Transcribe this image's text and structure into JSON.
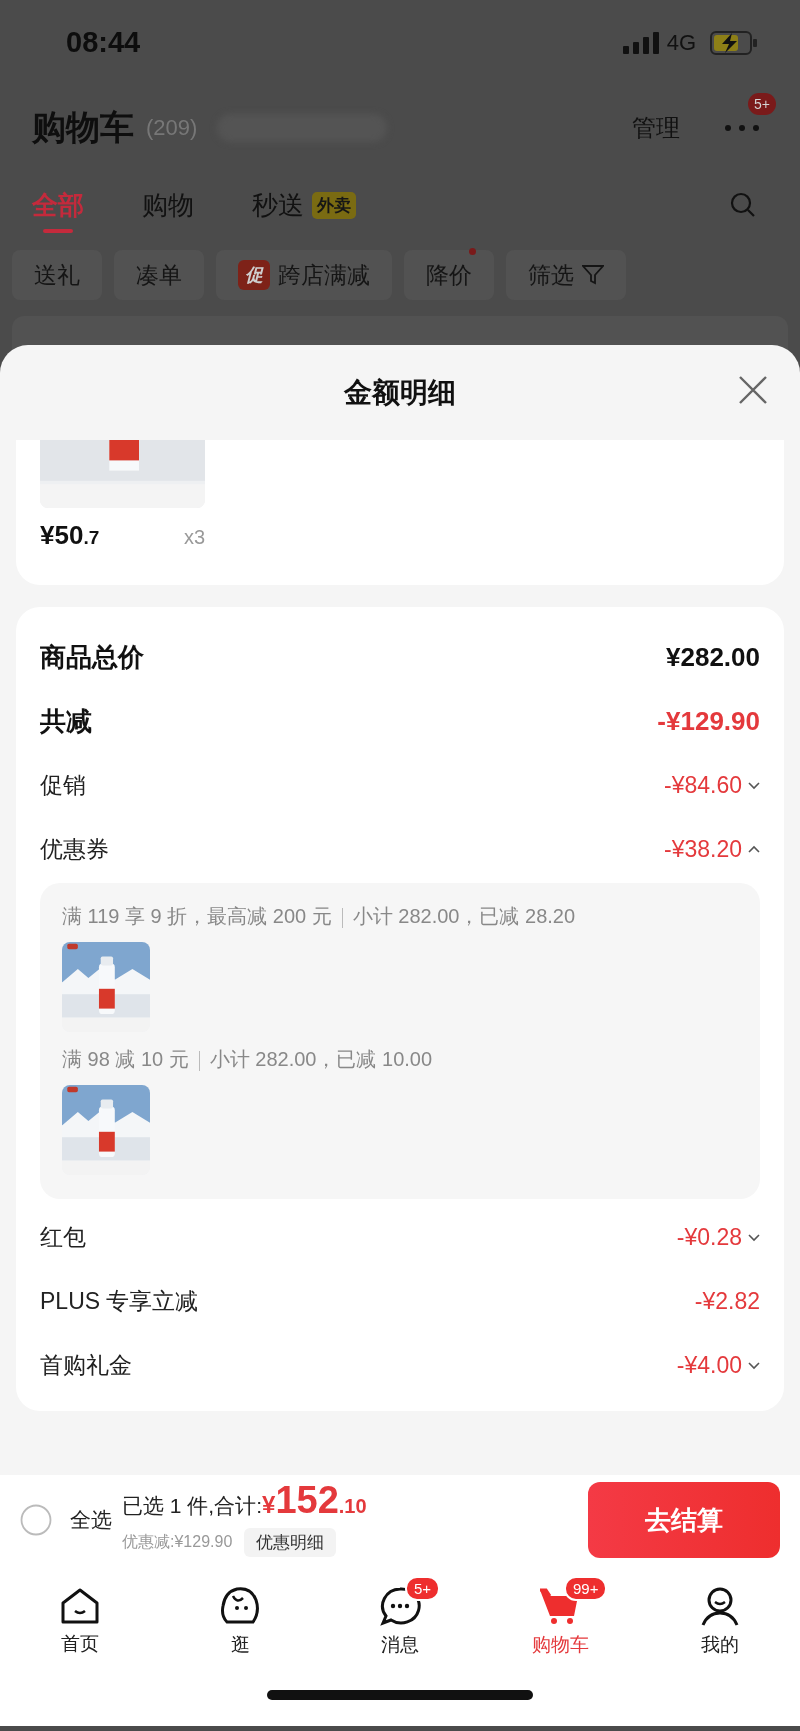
{
  "status_bar": {
    "time": "08:44",
    "network": "4G"
  },
  "header": {
    "title": "购物车",
    "count": "(209)",
    "manage": "管理",
    "more_badge": "5+"
  },
  "tabs": [
    {
      "label": "全部",
      "selected": true
    },
    {
      "label": "购物",
      "selected": false
    },
    {
      "label": "秒送",
      "tag": "外卖",
      "selected": false
    }
  ],
  "chips": [
    {
      "label": "送礼",
      "kind": "plain",
      "dot": false
    },
    {
      "label": "凑单",
      "kind": "plain",
      "dot": false
    },
    {
      "label": "跨店满减",
      "kind": "promo",
      "tag": "促",
      "dot": false
    },
    {
      "label": "降价",
      "kind": "plain",
      "dot": true
    },
    {
      "label": "筛选",
      "kind": "filter",
      "dot": false
    }
  ],
  "sheet": {
    "title": "金额明细",
    "product": {
      "kind": "picture",
      "price": "¥50",
      "price_fraction": ".7",
      "quantity": "x3"
    },
    "rows": [
      {
        "kind": "total",
        "label": "商品总价",
        "value": "¥282.00"
      },
      {
        "kind": "reduction",
        "label": "共减",
        "value": "-¥129.90"
      },
      {
        "kind": "expandable",
        "label": "促销",
        "value": "-¥84.60",
        "expanded": false
      },
      {
        "kind": "expandable",
        "label": "优惠券",
        "value": "-¥38.20",
        "expanded": true,
        "coupons": [
          {
            "rule": "满 119 享 9 折，最高减 200 元",
            "subtotal": "小计 282.00，已减 28.20",
            "kind": "picture"
          },
          {
            "rule": "满 98 减 10 元",
            "subtotal": "小计 282.00，已减 10.00",
            "kind": "picture"
          }
        ]
      },
      {
        "kind": "expandable",
        "label": "红包",
        "value": "-¥0.28",
        "expanded": false
      },
      {
        "kind": "plain",
        "label": "PLUS 专享立减",
        "value": "-¥2.82"
      },
      {
        "kind": "expandable",
        "label": "首购礼金",
        "value": "-¥4.00",
        "expanded": false
      }
    ]
  },
  "footer": {
    "select_all": {
      "label": "全选",
      "checked": false
    },
    "summary": "已选 1 件,合计:",
    "currency": "¥",
    "amount": "152",
    "amount_fraction": ".10",
    "discount": "优惠减:¥129.90",
    "detail_button": "优惠明细",
    "checkout": "去结算"
  },
  "tab_bar": [
    {
      "label": "首页",
      "selected": false
    },
    {
      "label": "逛",
      "selected": false
    },
    {
      "label": "消息",
      "badge": "5+",
      "selected": false
    },
    {
      "label": "购物车",
      "badge": "99+",
      "selected": true
    },
    {
      "label": "我的",
      "selected": false
    }
  ]
}
